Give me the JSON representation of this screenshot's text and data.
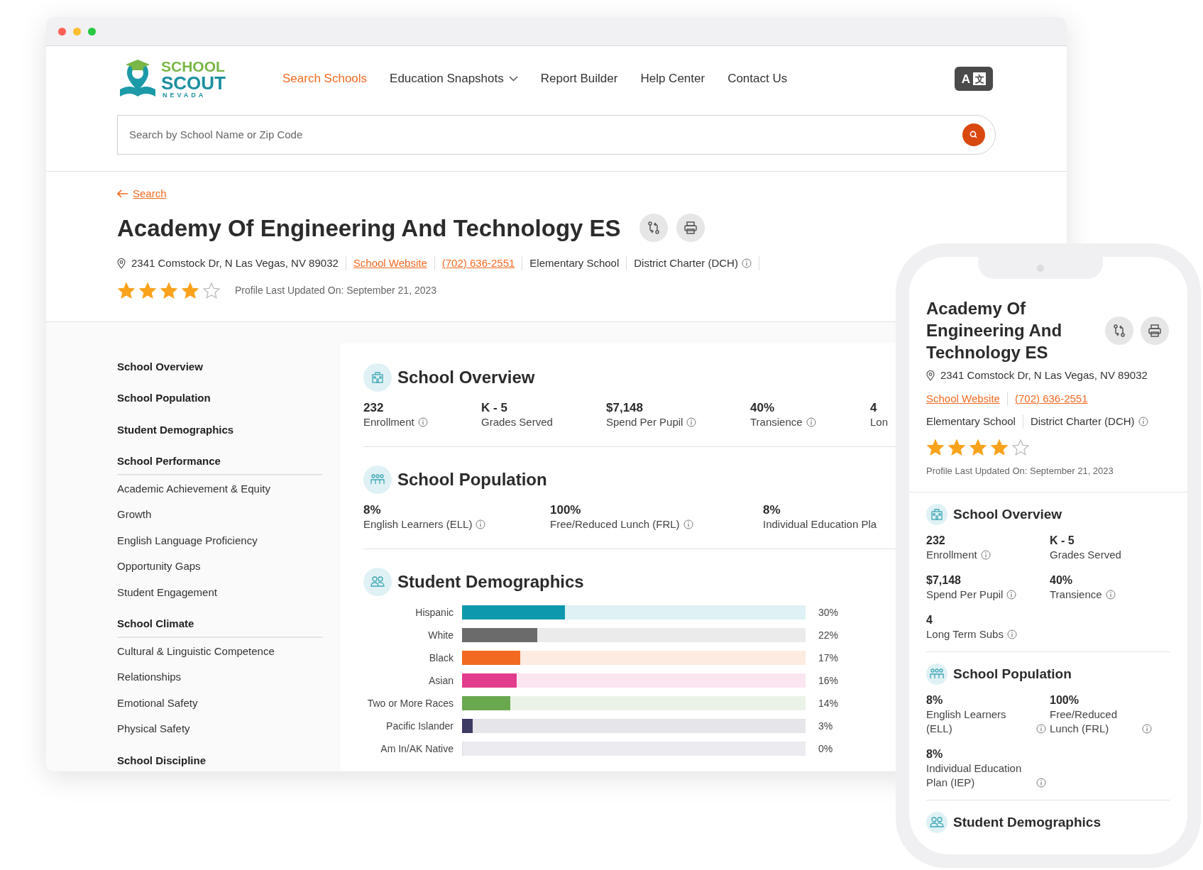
{
  "browser": {
    "logo": {
      "line1": "SCHOOL",
      "line2": "SCOUT",
      "line3": "NEVADA"
    },
    "nav": [
      {
        "label": "Search Schools",
        "selected": true,
        "has_menu": false
      },
      {
        "label": "Education Snapshots",
        "selected": false,
        "has_menu": true
      },
      {
        "label": "Report Builder",
        "selected": false,
        "has_menu": false
      },
      {
        "label": "Help Center",
        "selected": false,
        "has_menu": false
      },
      {
        "label": "Contact Us",
        "selected": false,
        "has_menu": false
      }
    ],
    "language_button": {
      "left": "A",
      "right": "文"
    },
    "search": {
      "placeholder": "Search by School Name or Zip Code"
    },
    "back_link": "Search",
    "school": {
      "name": "Academy Of Engineering And Technology ES",
      "address": "2341 Comstock Dr, N Las Vegas, NV 89032",
      "website": "School Website",
      "phone": "(702) 636-2551",
      "type": "Elementary School",
      "district": "District Charter (DCH)",
      "stars": 4,
      "updated": "Profile Last Updated On: September 21, 2023"
    },
    "sidebar": [
      {
        "label": "School Overview",
        "kind": "link"
      },
      {
        "label": "School Population",
        "kind": "link"
      },
      {
        "label": "Student Demographics",
        "kind": "link"
      },
      {
        "label": "School Performance",
        "kind": "group",
        "children": [
          {
            "label": "Academic Achievement & Equity"
          },
          {
            "label": "Growth"
          },
          {
            "label": "English Language Proficiency"
          },
          {
            "label": "Opportunity Gaps"
          },
          {
            "label": "Student Engagement"
          }
        ]
      },
      {
        "label": "School Climate",
        "kind": "group",
        "children": [
          {
            "label": "Cultural & Linguistic Competence"
          },
          {
            "label": "Relationships"
          },
          {
            "label": "Emotional Safety"
          },
          {
            "label": "Physical Safety"
          }
        ]
      },
      {
        "label": "School Discipline",
        "kind": "group"
      }
    ],
    "overview": {
      "title": "School Overview",
      "stats": [
        {
          "value": "232",
          "label": "Enrollment",
          "info": true
        },
        {
          "value": "K - 5",
          "label": "Grades Served",
          "info": false
        },
        {
          "value": "$7,148",
          "label": "Spend Per Pupil",
          "info": true
        },
        {
          "value": "40%",
          "label": "Transience",
          "info": true
        },
        {
          "value": "4",
          "label": "Lon",
          "info": false
        }
      ]
    },
    "population": {
      "title": "School Population",
      "stats": [
        {
          "value": "8%",
          "label": "English Learners (ELL)",
          "info": true
        },
        {
          "value": "100%",
          "label": "Free/Reduced Lunch (FRL)",
          "info": true
        },
        {
          "value": "8%",
          "label": "Individual Education Pla",
          "info": false
        }
      ]
    },
    "demographics": {
      "title": "Student Demographics",
      "rows": [
        {
          "label": "Hispanic",
          "level": 0.3,
          "reading": "30%",
          "color": "#0e98ad"
        },
        {
          "label": "White",
          "level": 0.22,
          "reading": "22%",
          "color": "#6b6b6b"
        },
        {
          "label": "Black",
          "level": 0.17,
          "reading": "17%",
          "color": "#f26a21"
        },
        {
          "label": "Asian",
          "level": 0.16,
          "reading": "16%",
          "color": "#e23d8c"
        },
        {
          "label": "Two or More Races",
          "level": 0.14,
          "reading": "14%",
          "color": "#6aa84f"
        },
        {
          "label": "Pacific Islander",
          "level": 0.03,
          "reading": "3%",
          "color": "#3d3b63"
        },
        {
          "label": "Am In/AK Native",
          "level": 0,
          "reading": "0%"
        }
      ]
    }
  },
  "phone": {
    "school": {
      "name": "Academy Of Engineering And Technology ES",
      "address": "2341 Comstock Dr, N Las Vegas, NV 89032",
      "website": "School Website",
      "phone": "(702) 636-2551",
      "type": "Elementary School",
      "district": "District Charter (DCH)",
      "stars": 4,
      "updated": "Profile Last Updated On: September 21, 2023"
    },
    "overview": {
      "title": "School Overview",
      "stats": [
        {
          "value": "232",
          "label": "Enrollment",
          "info": true
        },
        {
          "value": "K - 5",
          "label": "Grades Served",
          "info": false
        },
        {
          "value": "$7,148",
          "label": "Spend Per Pupil",
          "info": true
        },
        {
          "value": "40%",
          "label": "Transience",
          "info": true
        },
        {
          "value": "4",
          "label": "Long Term Subs",
          "info": true
        }
      ]
    },
    "population": {
      "title": "School Population",
      "stats": [
        {
          "value": "8%",
          "label": "English Learners (ELL)",
          "info": true
        },
        {
          "value": "100%",
          "label": "Free/Reduced Lunch (FRL)",
          "info": true
        },
        {
          "value": "8%",
          "label": "Individual Education Plan (IEP)",
          "info": true
        }
      ]
    },
    "demographics": {
      "title": "Student Demographics"
    }
  }
}
